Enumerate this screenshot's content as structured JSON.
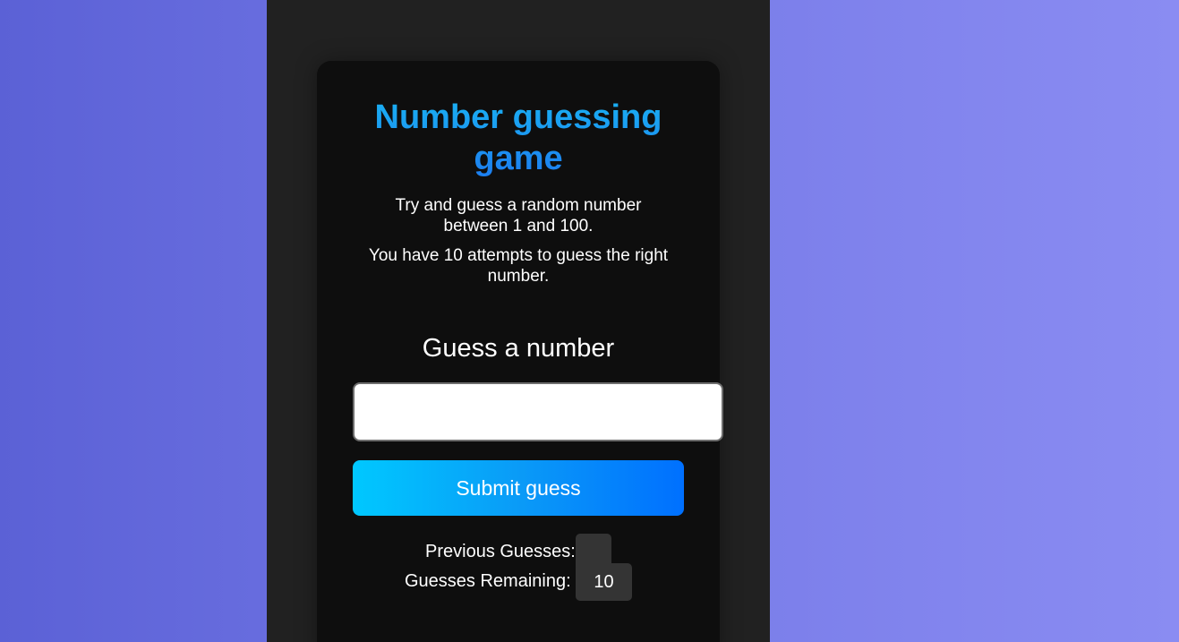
{
  "game": {
    "title": "Number guessing game",
    "description_line1": "Try and guess a random number between 1 and 100.",
    "description_line2": "You have 10 attempts to guess the right number.",
    "guess_label": "Guess a number",
    "input_value": "",
    "input_placeholder": "",
    "submit_label": "Submit guess",
    "previous_guesses_label": "Previous Guesses:",
    "previous_guesses_value": "",
    "guesses_remaining_label": "Guesses Remaining:",
    "guesses_remaining_value": "10"
  },
  "colors": {
    "background_gradient_start": "#5b61d6",
    "background_gradient_end": "#8a8cf2",
    "column_background": "#212121",
    "card_background": "#0e0e0e",
    "title_gradient_start": "#1ab1f2",
    "title_gradient_end": "#1c7df0",
    "button_gradient_start": "#00c8ff",
    "button_gradient_end": "#0070ff"
  }
}
